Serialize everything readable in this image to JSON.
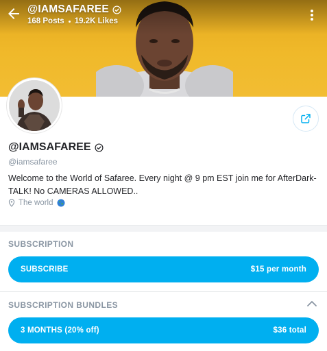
{
  "header": {
    "title": "@IAMSAFAREE",
    "posts": "168 Posts",
    "likes": "19.2K Likes"
  },
  "profile": {
    "display_name": "@IAMSAFAREE",
    "username": "@iamsafaree",
    "bio": "Welcome to the World of Safaree. Every night @ 9 pm EST join me for AfterDark-TALK! No CAMERAS ALLOWED..",
    "location": "The world"
  },
  "subscription": {
    "section_title": "SUBSCRIPTION",
    "button_label": "SUBSCRIBE",
    "price": "$15 per month"
  },
  "bundles": {
    "section_title": "SUBSCRIPTION BUNDLES",
    "items": [
      {
        "label": "3 MONTHS (20% off)",
        "price": "$36 total"
      }
    ]
  },
  "colors": {
    "accent": "#00aff0",
    "banner": "#f0b92a",
    "muted_text": "#8a96a3"
  },
  "icons": [
    "back-arrow-icon",
    "verified-badge-icon",
    "more-vertical-icon",
    "share-icon",
    "location-pin-icon",
    "globe-icon",
    "chevron-up-icon"
  ]
}
